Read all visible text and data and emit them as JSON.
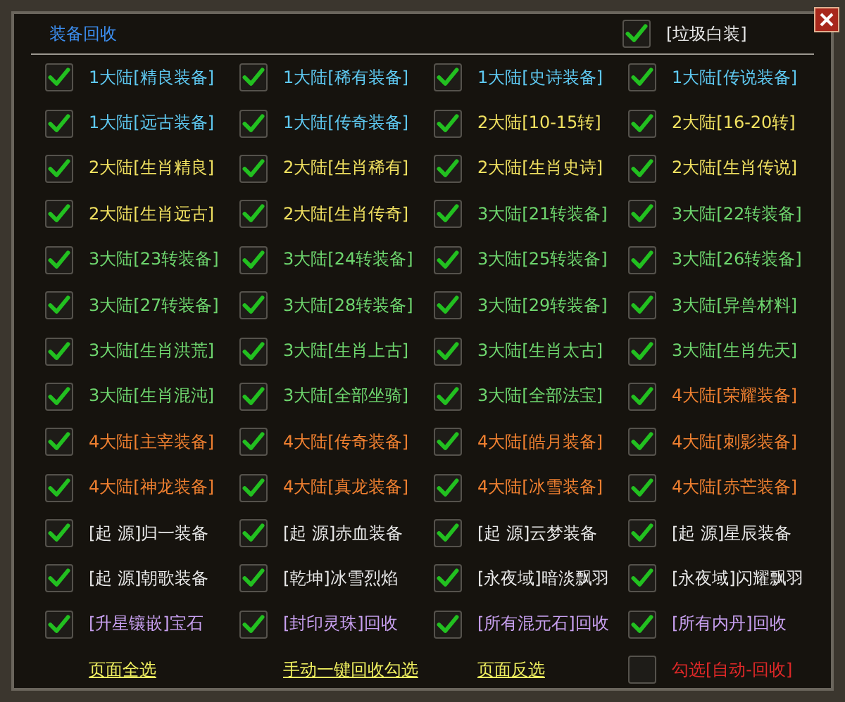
{
  "window": {
    "title": "装备回收"
  },
  "junk": {
    "label": "[垃圾白装]",
    "checked": true
  },
  "items": [
    {
      "label": "1大陆[精良装备]",
      "color": "#5ec8f0",
      "checked": true
    },
    {
      "label": "1大陆[稀有装备]",
      "color": "#5ec8f0",
      "checked": true
    },
    {
      "label": "1大陆[史诗装备]",
      "color": "#5ec8f0",
      "checked": true
    },
    {
      "label": "1大陆[传说装备]",
      "color": "#5ec8f0",
      "checked": true
    },
    {
      "label": "1大陆[远古装备]",
      "color": "#5ec8f0",
      "checked": true
    },
    {
      "label": "1大陆[传奇装备]",
      "color": "#5ec8f0",
      "checked": true
    },
    {
      "label": "2大陆[10-15转]",
      "color": "#f0e060",
      "checked": true
    },
    {
      "label": "2大陆[16-20转]",
      "color": "#f0e060",
      "checked": true
    },
    {
      "label": "2大陆[生肖精良]",
      "color": "#f0e060",
      "checked": true
    },
    {
      "label": "2大陆[生肖稀有]",
      "color": "#f0e060",
      "checked": true
    },
    {
      "label": "2大陆[生肖史诗]",
      "color": "#f0e060",
      "checked": true
    },
    {
      "label": "2大陆[生肖传说]",
      "color": "#f0e060",
      "checked": true
    },
    {
      "label": "2大陆[生肖远古]",
      "color": "#f0e060",
      "checked": true
    },
    {
      "label": "2大陆[生肖传奇]",
      "color": "#f0e060",
      "checked": true
    },
    {
      "label": "3大陆[21转装备]",
      "color": "#6ed66e",
      "checked": true
    },
    {
      "label": "3大陆[22转装备]",
      "color": "#6ed66e",
      "checked": true
    },
    {
      "label": "3大陆[23转装备]",
      "color": "#6ed66e",
      "checked": true
    },
    {
      "label": "3大陆[24转装备]",
      "color": "#6ed66e",
      "checked": true
    },
    {
      "label": "3大陆[25转装备]",
      "color": "#6ed66e",
      "checked": true
    },
    {
      "label": "3大陆[26转装备]",
      "color": "#6ed66e",
      "checked": true
    },
    {
      "label": "3大陆[27转装备]",
      "color": "#6ed66e",
      "checked": true
    },
    {
      "label": "3大陆[28转装备]",
      "color": "#6ed66e",
      "checked": true
    },
    {
      "label": "3大陆[29转装备]",
      "color": "#6ed66e",
      "checked": true
    },
    {
      "label": "3大陆[异兽材料]",
      "color": "#6ed66e",
      "checked": true
    },
    {
      "label": "3大陆[生肖洪荒]",
      "color": "#6ed66e",
      "checked": true
    },
    {
      "label": "3大陆[生肖上古]",
      "color": "#6ed66e",
      "checked": true
    },
    {
      "label": "3大陆[生肖太古]",
      "color": "#6ed66e",
      "checked": true
    },
    {
      "label": "3大陆[生肖先天]",
      "color": "#6ed66e",
      "checked": true
    },
    {
      "label": "3大陆[生肖混沌]",
      "color": "#6ed66e",
      "checked": true
    },
    {
      "label": "3大陆[全部坐骑]",
      "color": "#6ed66e",
      "checked": true
    },
    {
      "label": "3大陆[全部法宝]",
      "color": "#6ed66e",
      "checked": true
    },
    {
      "label": "4大陆[荣耀装备]",
      "color": "#f08030",
      "checked": true
    },
    {
      "label": "4大陆[主宰装备]",
      "color": "#f08030",
      "checked": true
    },
    {
      "label": "4大陆[传奇装备]",
      "color": "#f08030",
      "checked": true
    },
    {
      "label": "4大陆[皓月装备]",
      "color": "#f08030",
      "checked": true
    },
    {
      "label": "4大陆[刺影装备]",
      "color": "#f08030",
      "checked": true
    },
    {
      "label": "4大陆[神龙装备]",
      "color": "#f08030",
      "checked": true
    },
    {
      "label": "4大陆[真龙装备]",
      "color": "#f08030",
      "checked": true
    },
    {
      "label": "4大陆[冰雪装备]",
      "color": "#f08030",
      "checked": true
    },
    {
      "label": "4大陆[赤芒装备]",
      "color": "#f08030",
      "checked": true
    },
    {
      "label": "[起 源]归一装备",
      "color": "#e8e8e8",
      "checked": true
    },
    {
      "label": "[起 源]赤血装备",
      "color": "#e8e8e8",
      "checked": true
    },
    {
      "label": "[起 源]云梦装备",
      "color": "#e8e8e8",
      "checked": true
    },
    {
      "label": "[起 源]星辰装备",
      "color": "#e8e8e8",
      "checked": true
    },
    {
      "label": "[起 源]朝歌装备",
      "color": "#e8e8e8",
      "checked": true
    },
    {
      "label": "[乾坤]冰雪烈焰",
      "color": "#e8e8e8",
      "checked": true
    },
    {
      "label": "[永夜域]暗淡飘羽",
      "color": "#e8e8e8",
      "checked": true
    },
    {
      "label": "[永夜域]闪耀飘羽",
      "color": "#e8e8e8",
      "checked": true
    },
    {
      "label": "[升星镶嵌]宝石",
      "color": "#c8a0f0",
      "checked": true
    },
    {
      "label": "[封印灵珠]回收",
      "color": "#c8a0f0",
      "checked": true
    },
    {
      "label": "[所有混元石]回收",
      "color": "#c8a0f0",
      "checked": true
    },
    {
      "label": "[所有内丹]回收",
      "color": "#c8a0f0",
      "checked": true
    }
  ],
  "footer": {
    "links": [
      "页面全选",
      "手动一键回收勾选",
      "页面反选"
    ],
    "auto": {
      "label": "勾选[自动-回收]",
      "checked": false
    }
  }
}
